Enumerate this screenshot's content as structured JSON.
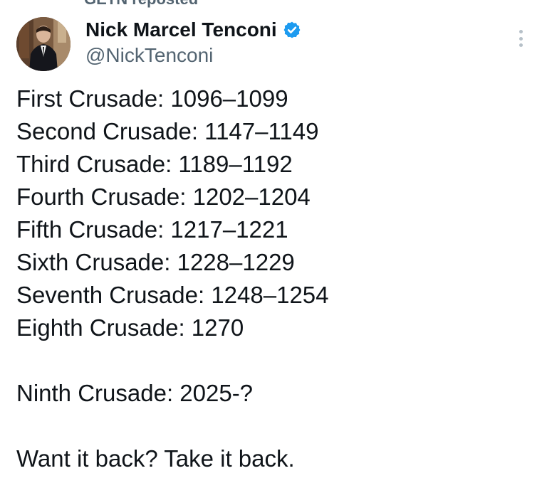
{
  "repost": {
    "text": "GETN reposted"
  },
  "author": {
    "display_name": "Nick Marcel Tenconi",
    "handle": "@NickTenconi",
    "verified": true,
    "verified_color": "#1d9bf0",
    "avatar_icon": "profile-photo"
  },
  "more_icon": "more-vertical-icon",
  "tweet": {
    "lines": [
      "First Crusade: 1096–1099",
      "Second Crusade: 1147–1149",
      "Third Crusade: 1189–1192",
      "Fourth Crusade: 1202–1204",
      "Fifth Crusade: 1217–1221",
      "Sixth Crusade: 1228–1229",
      "Seventh Crusade: 1248–1254",
      "Eighth Crusade: 1270"
    ],
    "ninth": "Ninth Crusade: 2025-?",
    "closing": "Want it back? Take it back."
  }
}
